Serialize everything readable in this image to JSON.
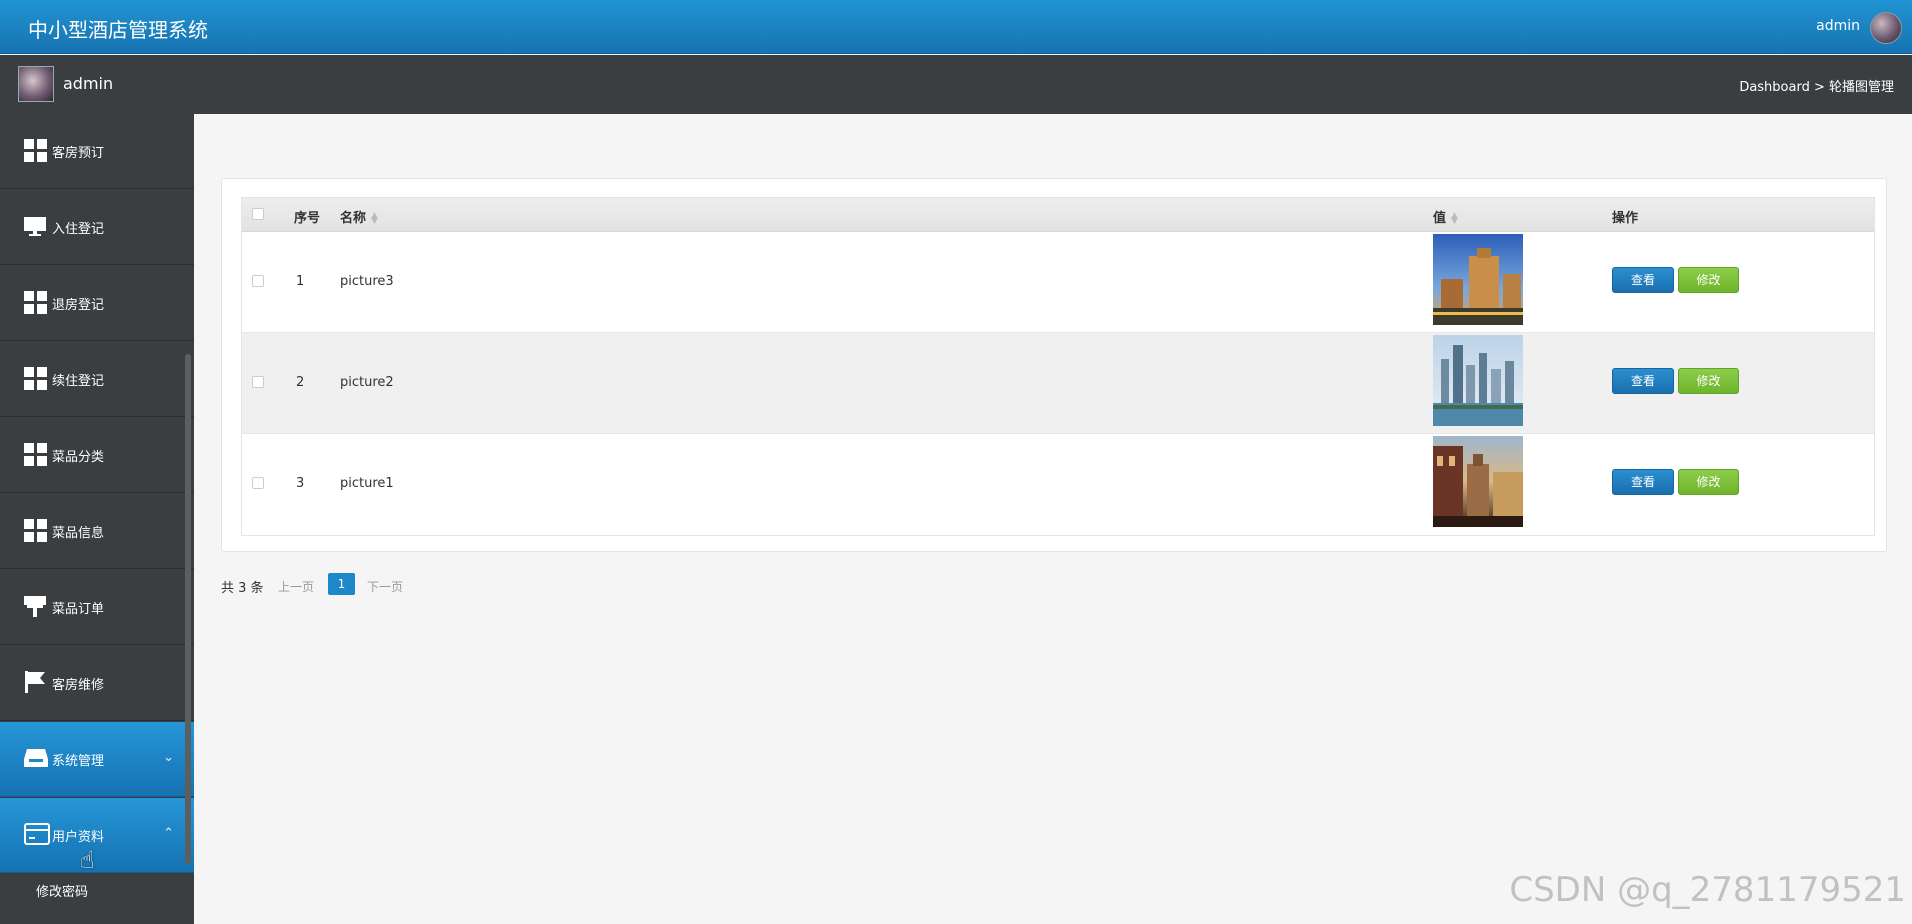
{
  "header": {
    "app_title": "中小型酒店管理系统",
    "user": "admin"
  },
  "subbar": {
    "user": "admin",
    "breadcrumb": "Dashboard > 轮播图管理"
  },
  "sidebar": {
    "items": [
      {
        "label": "客房预订",
        "icon": "grid-icon"
      },
      {
        "label": "入住登记",
        "icon": "monitor-icon"
      },
      {
        "label": "退房登记",
        "icon": "grid-icon"
      },
      {
        "label": "续住登记",
        "icon": "grid-icon"
      },
      {
        "label": "菜品分类",
        "icon": "grid-icon"
      },
      {
        "label": "菜品信息",
        "icon": "grid-icon"
      },
      {
        "label": "菜品订单",
        "icon": "paint-roller-icon"
      },
      {
        "label": "客房维修",
        "icon": "flag-icon"
      },
      {
        "label": "系统管理",
        "icon": "inbox-icon",
        "expand": "chevron-down-icon"
      },
      {
        "label": "用户资料",
        "icon": "card-icon",
        "expand": "chevron-up-icon"
      }
    ],
    "subitems": [
      {
        "label": "修改密码"
      }
    ]
  },
  "table": {
    "headers": {
      "index": "序号",
      "name": "名称",
      "value": "值",
      "actions": "操作"
    },
    "rows": [
      {
        "index": "1",
        "name": "picture3",
        "view": "查看",
        "edit": "修改"
      },
      {
        "index": "2",
        "name": "picture2",
        "view": "查看",
        "edit": "修改"
      },
      {
        "index": "3",
        "name": "picture1",
        "view": "查看",
        "edit": "修改"
      }
    ]
  },
  "pagination": {
    "total": "共 3 条",
    "prev": "上一页",
    "current": "1",
    "next": "下一页"
  },
  "watermark": "CSDN @q_2781179521",
  "colors": {
    "primary": "#1e87c9",
    "success": "#7bbf3a",
    "sidebar": "#3a3e40"
  }
}
